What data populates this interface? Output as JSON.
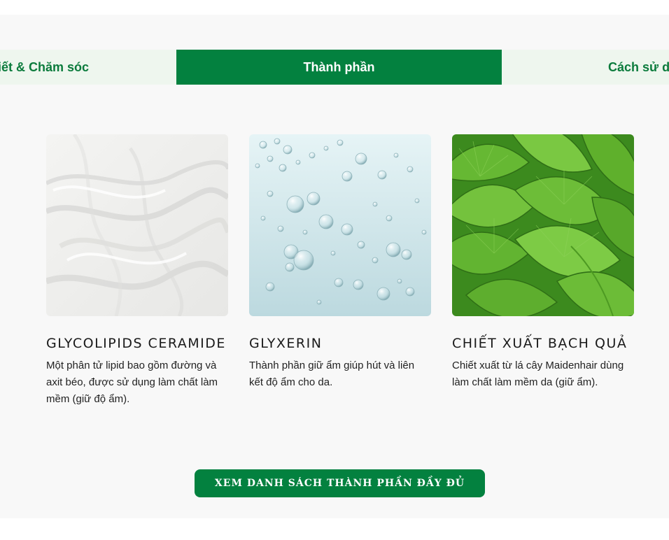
{
  "tabs": {
    "left_label": "Chi tiết & Chăm sóc",
    "active_label": "Thành phần",
    "right_label": "Cách sử dụng"
  },
  "ingredients": [
    {
      "title": "GLYCOLIPIDS CERAMIDE",
      "description": "Một phân tử lipid bao gồm đường và axit béo, được sử dụng làm chất làm mềm (giữ độ ẩm).",
      "image": "white-cream-texture"
    },
    {
      "title": "GLYXERIN",
      "description": "Thành phần giữ ẩm giúp hút và liên kết độ ẩm cho da.",
      "image": "water-bubbles"
    },
    {
      "title": "CHIẾT XUẤT BẠCH QUẢ",
      "description": "Chiết xuất từ lá cây Maidenhair dùng làm chất làm mềm da (giữ ẩm).",
      "image": "ginkgo-leaves"
    }
  ],
  "cta": {
    "label": "XEM DANH SÁCH THÀNH PHẦN ĐẦY ĐỦ"
  },
  "colors": {
    "brand_green": "#03813f",
    "tab_bg_light": "#eef6ee",
    "section_bg": "#f8f8f8"
  }
}
